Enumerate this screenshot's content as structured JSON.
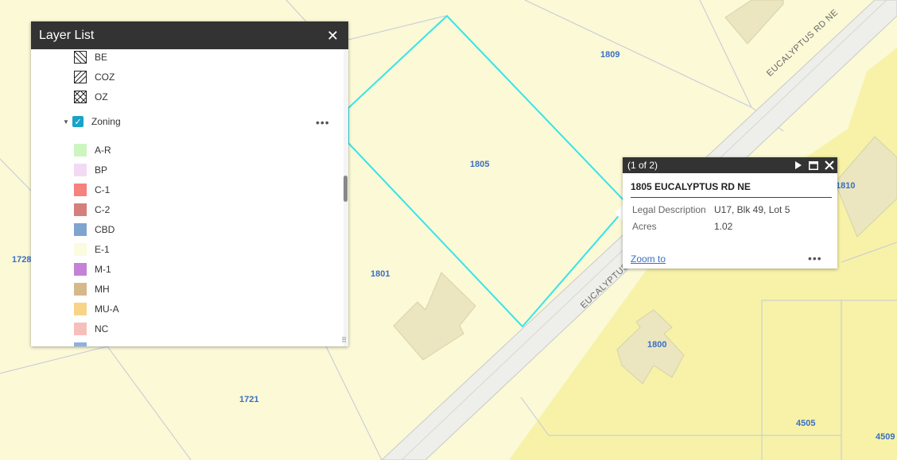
{
  "map": {
    "parcels": [
      "1809",
      "1805",
      "1801",
      "1728",
      "1721",
      "1810",
      "1800",
      "4505",
      "4509"
    ],
    "roads": [
      "EUCALYPTUS RD NE",
      "EUCALYPTUS"
    ],
    "highlight_color": "#37e4e8",
    "background_color": "#fbf9d6"
  },
  "layer_list": {
    "title": "Layer List",
    "close_icon": "✕",
    "overlay_items": [
      {
        "label": "BE",
        "pattern": "hatch-diag-back"
      },
      {
        "label": "COZ",
        "pattern": "hatch-diag-fwd"
      },
      {
        "label": "OZ",
        "pattern": "hatch-cross"
      }
    ],
    "zoning_layer": {
      "label": "Zoning",
      "checked": true,
      "more": "•••"
    },
    "zoning_items": [
      {
        "label": "A-R",
        "color": "#ccf5c0"
      },
      {
        "label": "BP",
        "color": "#f2daf5"
      },
      {
        "label": "C-1",
        "color": "#f5827c"
      },
      {
        "label": "C-2",
        "color": "#d57f7c"
      },
      {
        "label": "CBD",
        "color": "#7fa4cf"
      },
      {
        "label": "E-1",
        "color": "#fbfbe0"
      },
      {
        "label": "M-1",
        "color": "#c482d6"
      },
      {
        "label": "MH",
        "color": "#d5b98b"
      },
      {
        "label": "MU-A",
        "color": "#f8d489"
      },
      {
        "label": "NC",
        "color": "#f7bfbb"
      },
      {
        "label": "",
        "color": "#8cb1e4"
      }
    ]
  },
  "popup": {
    "counter": "(1 of 2)",
    "title": "1805 EUCALYPTUS RD NE",
    "fields": [
      {
        "name": "Legal Description",
        "value": "U17, Blk 49, Lot 5"
      },
      {
        "name": "Acres",
        "value": "1.02"
      }
    ],
    "zoom_label": "Zoom to",
    "more": "•••"
  }
}
